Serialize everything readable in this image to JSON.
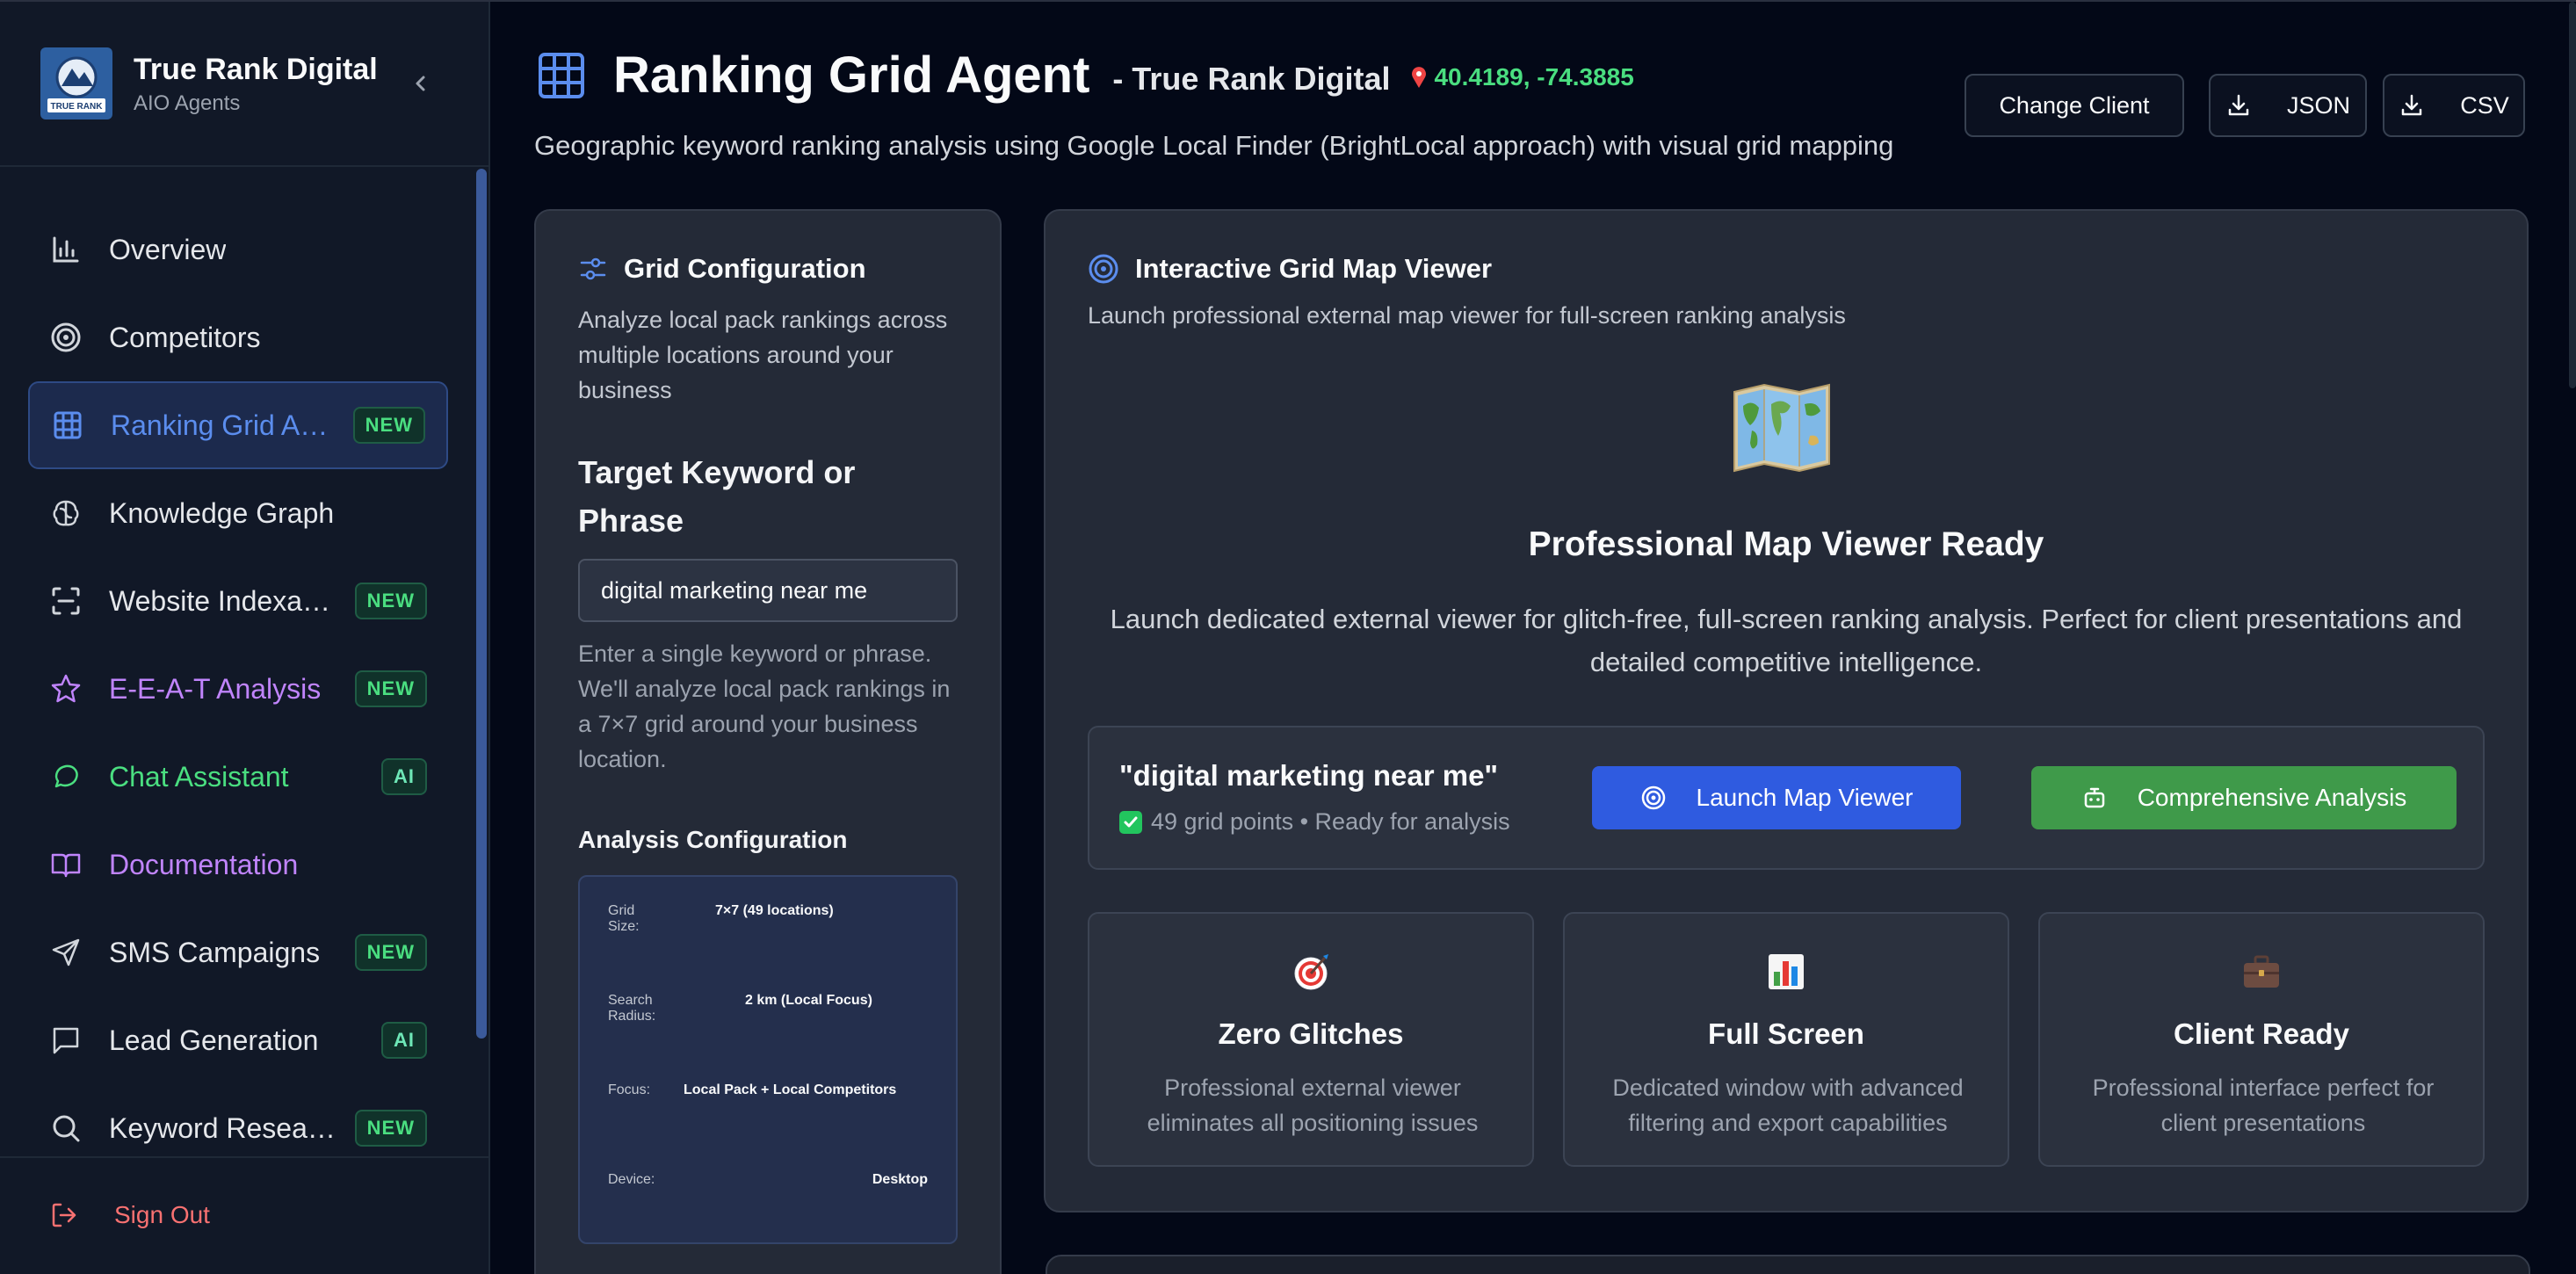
{
  "sidebar": {
    "brand_name": "True Rank Digital",
    "brand_sub": "AIO Agents",
    "logo_text": "TRUE RANK",
    "items": [
      {
        "label": "Overview",
        "icon": "bar-chart-icon",
        "color": "#e5e7eb"
      },
      {
        "label": "Competitors",
        "icon": "target-icon",
        "color": "#e5e7eb"
      },
      {
        "label": "Ranking Grid Agent",
        "icon": "grid-icon",
        "color": "#5b8dee",
        "badge": "NEW",
        "active": true
      },
      {
        "label": "Knowledge Graph",
        "icon": "brain-icon",
        "color": "#e5e7eb"
      },
      {
        "label": "Website Indexability",
        "icon": "scan-icon",
        "color": "#e5e7eb",
        "badge": "NEW"
      },
      {
        "label": "E-E-A-T Analysis",
        "icon": "star-icon",
        "color": "#c084fc",
        "badge": "NEW"
      },
      {
        "label": "Chat Assistant",
        "icon": "chat-bubble-icon",
        "color": "#4ade80",
        "badge": "AI"
      },
      {
        "label": "Documentation",
        "icon": "book-icon",
        "color": "#c084fc"
      },
      {
        "label": "SMS Campaigns",
        "icon": "send-icon",
        "color": "#e5e7eb",
        "badge": "NEW"
      },
      {
        "label": "Lead Generation",
        "icon": "message-square-icon",
        "color": "#e5e7eb",
        "badge": "AI"
      },
      {
        "label": "Keyword Research",
        "icon": "search-icon",
        "color": "#e5e7eb",
        "badge": "NEW"
      }
    ],
    "sign_out": "Sign Out"
  },
  "header": {
    "title": "Ranking Grid Agent",
    "client": "- True Rank Digital",
    "coords": "40.4189, -74.3885",
    "description": "Geographic keyword ranking analysis using Google Local Finder (BrightLocal approach) with visual grid mapping",
    "change_client": "Change Client",
    "json_btn": "JSON",
    "csv_btn": "CSV"
  },
  "config": {
    "title": "Grid Configuration",
    "description": "Analyze local pack rankings across multiple locations around your business",
    "keyword_label": "Target Keyword or Phrase",
    "keyword_value": "digital marketing near me",
    "keyword_help": "Enter a single keyword or phrase. We'll analyze local pack rankings in a 7×7 grid around your business location.",
    "analysis_title": "Analysis Configuration",
    "grid_size_key": "Grid Size:",
    "grid_size_val": "7×7 (49 locations)",
    "radius_key": "Search Radius:",
    "radius_val": "2 km (Local Focus)",
    "focus_key": "Focus:",
    "focus_val": "Local Pack + Local Competitors",
    "device_key": "Device:",
    "device_val": "Desktop"
  },
  "viewer": {
    "title": "Interactive Grid Map Viewer",
    "description": "Launch professional external map viewer for full-screen ranking analysis",
    "ready_title": "Professional Map Viewer Ready",
    "ready_desc": "Launch dedicated external viewer for glitch-free, full-screen ranking analysis. Perfect for client presentations and detailed competitive intelligence.",
    "keyword_quoted": "\"digital marketing near me\"",
    "status": "49 grid points • Ready for analysis",
    "launch_btn": "Launch Map Viewer",
    "analysis_btn": "Comprehensive Analysis",
    "features": [
      {
        "title": "Zero Glitches",
        "desc": "Professional external viewer eliminates all positioning issues",
        "icon": "dart-target-icon"
      },
      {
        "title": "Full Screen",
        "desc": "Dedicated window with advanced filtering and export capabilities",
        "icon": "bar-chart-emoji-icon"
      },
      {
        "title": "Client Ready",
        "desc": "Professional interface perfect for client presentations",
        "icon": "briefcase-icon"
      }
    ]
  },
  "colors": {
    "accent_blue": "#2f5be0",
    "accent_green": "#3f9a4a",
    "coords_green": "#4ade80",
    "sign_out_red": "#f87171"
  }
}
